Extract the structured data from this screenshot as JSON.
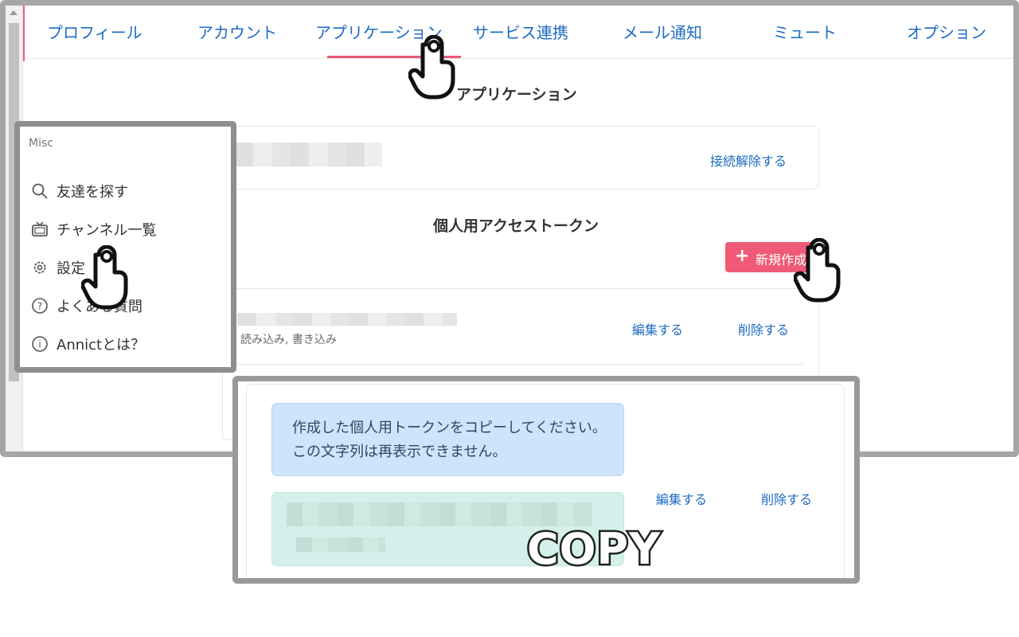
{
  "tabs": [
    {
      "label": "プロフィール"
    },
    {
      "label": "アカウント"
    },
    {
      "label": "アプリケーション",
      "active": true
    },
    {
      "label": "サービス連携"
    },
    {
      "label": "メール通知"
    },
    {
      "label": "ミュート"
    },
    {
      "label": "オプション"
    }
  ],
  "applications": {
    "title": "アプリケーション",
    "disconnect_label": "接続解除する"
  },
  "tokens": {
    "title": "個人用アクセストークン",
    "new_button_label": "新規作成",
    "scopes": "読み込み, 書き込み",
    "edit_label": "編集する",
    "delete_label": "削除する"
  },
  "sidebar": {
    "title": "Misc",
    "items": [
      {
        "label": "友達を探す",
        "icon": "search-icon"
      },
      {
        "label": "チャンネル一覧",
        "icon": "tv-icon"
      },
      {
        "label": "設定",
        "icon": "gear-icon"
      },
      {
        "label": "よくある質問",
        "icon": "question-icon"
      },
      {
        "label": "Annictとは？",
        "icon": "info-icon"
      }
    ]
  },
  "copy_panel": {
    "message": "作成した個人用トークンをコピーしてください。この文字列は再表示できません。",
    "edit_label": "編集する",
    "delete_label": "削除する"
  },
  "annotation": {
    "copy_label": "COPY"
  },
  "colors": {
    "accent": "#ef5b76",
    "link": "#1e6bc2",
    "info_bg": "#cfe4fa",
    "token_bg": "#d3f1ea"
  }
}
